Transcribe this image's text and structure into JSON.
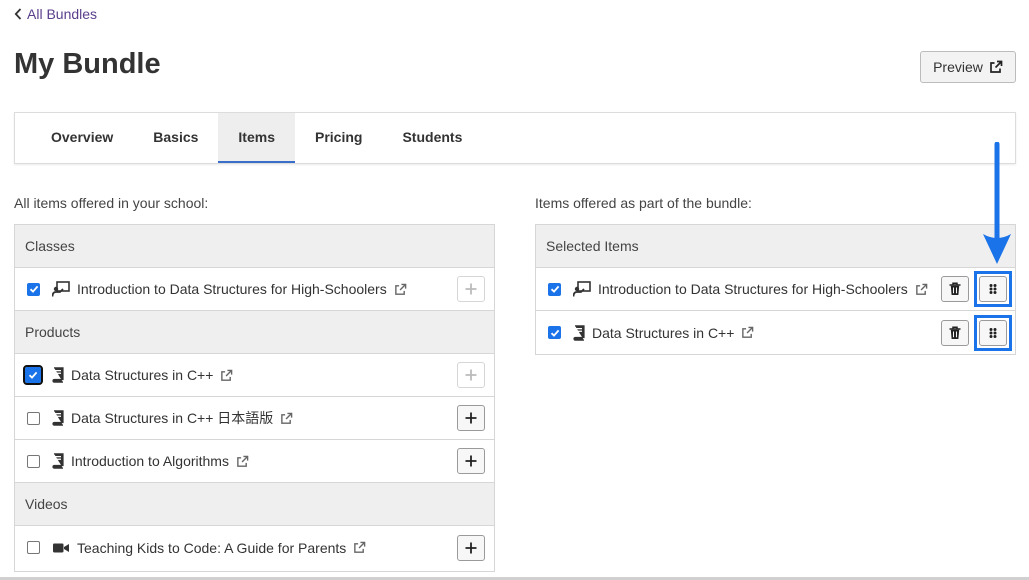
{
  "nav": {
    "back_label": "All Bundles"
  },
  "page": {
    "title": "My Bundle",
    "preview_label": "Preview"
  },
  "tabs": [
    {
      "label": "Overview",
      "active": false
    },
    {
      "label": "Basics",
      "active": false
    },
    {
      "label": "Items",
      "active": true
    },
    {
      "label": "Pricing",
      "active": false
    },
    {
      "label": "Students",
      "active": false
    }
  ],
  "left": {
    "label": "All items offered in your school:",
    "groups": [
      {
        "header": "Classes",
        "items": [
          {
            "name": "Introduction to Data Structures for High-Schoolers",
            "type": "class",
            "checked": true,
            "add_enabled": false
          }
        ]
      },
      {
        "header": "Products",
        "items": [
          {
            "name": "Data Structures in C++",
            "type": "product",
            "checked": true,
            "add_enabled": false
          },
          {
            "name": "Data Structures in C++ 日本語版",
            "type": "product",
            "checked": false,
            "add_enabled": true
          },
          {
            "name": "Introduction to Algorithms",
            "type": "product",
            "checked": false,
            "add_enabled": true
          }
        ]
      },
      {
        "header": "Videos",
        "items": [
          {
            "name": "Teaching Kids to Code: A Guide for Parents",
            "type": "video",
            "checked": false,
            "add_enabled": true
          }
        ]
      }
    ]
  },
  "right": {
    "label": "Items offered as part of the bundle:",
    "header": "Selected Items",
    "items": [
      {
        "name": "Introduction to Data Structures for High-Schoolers",
        "type": "class",
        "checked": true
      },
      {
        "name": "Data Structures in C++",
        "type": "product",
        "checked": true
      }
    ]
  },
  "colors": {
    "accent": "#1a73e8",
    "tab_underline": "#3a6fc9",
    "back_link": "#5a3e8c"
  },
  "icons": {
    "class": "presentation-icon",
    "product": "book-icon",
    "video": "video-camera-icon",
    "external": "external-link-icon",
    "add": "plus-icon",
    "delete": "trash-icon",
    "drag": "drag-handle-icon"
  }
}
